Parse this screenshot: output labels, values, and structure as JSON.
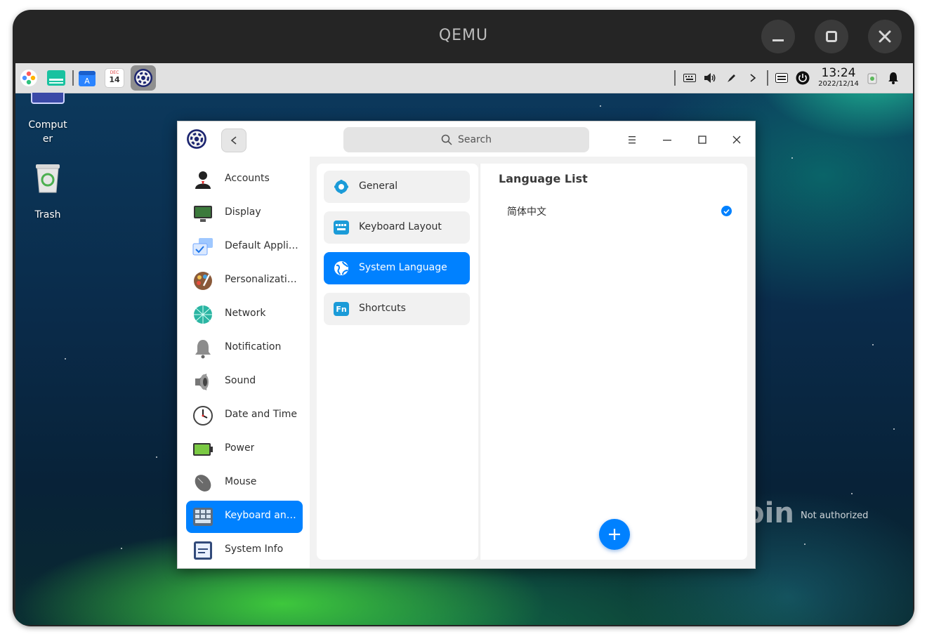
{
  "qemu": {
    "title": "QEMU"
  },
  "taskbar": {
    "clock_time": "13:24",
    "clock_date": "2022/12/14",
    "calendar_month": "DEC",
    "calendar_day": "14"
  },
  "desktop": {
    "icons": [
      {
        "label": "Comput\ner"
      },
      {
        "label": "Trash"
      }
    ],
    "watermark": "pin",
    "status_text": "Not authorized"
  },
  "window": {
    "search_label": "Search",
    "nav": [
      {
        "label": "Accounts",
        "icon": "accounts-icon"
      },
      {
        "label": "Display",
        "icon": "display-icon"
      },
      {
        "label": "Default Applic...",
        "icon": "default-apps-icon"
      },
      {
        "label": "Personalization",
        "icon": "personalization-icon"
      },
      {
        "label": "Network",
        "icon": "network-icon"
      },
      {
        "label": "Notification",
        "icon": "notification-icon"
      },
      {
        "label": "Sound",
        "icon": "sound-icon"
      },
      {
        "label": "Date and Time",
        "icon": "clock-icon"
      },
      {
        "label": "Power",
        "icon": "battery-icon"
      },
      {
        "label": "Mouse",
        "icon": "mouse-icon"
      },
      {
        "label": "Keyboard and ...",
        "icon": "keyboard-icon",
        "active": true
      },
      {
        "label": "System Info",
        "icon": "system-info-icon"
      }
    ],
    "sub": [
      {
        "label": "General",
        "icon": "gear-icon"
      },
      {
        "label": "Keyboard Layout",
        "icon": "keyboard-layout-icon"
      },
      {
        "label": "System Language",
        "icon": "globe-icon",
        "active": true
      },
      {
        "label": "Shortcuts",
        "icon": "fn-icon"
      }
    ],
    "detail": {
      "title": "Language List",
      "languages": [
        {
          "label": "简体中文",
          "selected": true
        }
      ]
    }
  },
  "colors": {
    "accent": "#0081ff",
    "taskbar": "#e1e1e1"
  }
}
